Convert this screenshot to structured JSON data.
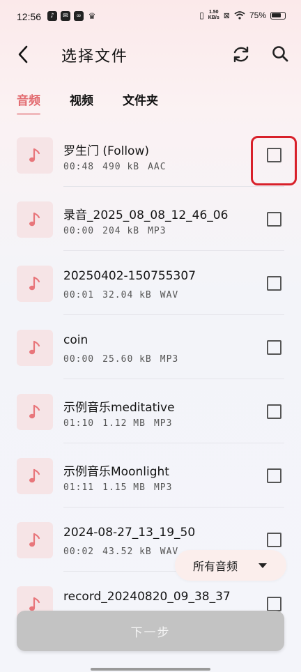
{
  "status_bar": {
    "time": "12:56",
    "net_speed_value": "1.50",
    "net_speed_unit": "KB/s",
    "battery": "75%"
  },
  "app_bar": {
    "title": "选择文件",
    "icons": [
      "back-arrow-icon",
      "refresh-icon",
      "search-icon"
    ]
  },
  "tabs": [
    {
      "label": "音频",
      "active": true
    },
    {
      "label": "视频",
      "active": false
    },
    {
      "label": "文件夹",
      "active": false
    }
  ],
  "files": [
    {
      "name": "罗生门 (Follow)",
      "duration": "00:48",
      "size": "490 kB",
      "format": "AAC",
      "checked": false
    },
    {
      "name": "录音_2025_08_08_12_46_06",
      "duration": "00:00",
      "size": "204 kB",
      "format": "MP3",
      "checked": false
    },
    {
      "name": "20250402-150755307",
      "duration": "00:01",
      "size": "32.04 kB",
      "format": "WAV",
      "checked": false
    },
    {
      "name": "coin",
      "duration": "00:00",
      "size": "25.60 kB",
      "format": "MP3",
      "checked": false
    },
    {
      "name": "示例音乐meditative",
      "duration": "01:10",
      "size": "1.12 MB",
      "format": "MP3",
      "checked": false
    },
    {
      "name": "示例音乐Moonlight",
      "duration": "01:11",
      "size": "1.15 MB",
      "format": "MP3",
      "checked": false
    },
    {
      "name": "2024-08-27_13_19_50",
      "duration": "00:02",
      "size": "43.52 kB",
      "format": "WAV",
      "checked": false
    },
    {
      "name": "record_20240820_09_38_37",
      "duration": "",
      "size": "",
      "format": "",
      "checked": false
    }
  ],
  "filter": {
    "label": "所有音频"
  },
  "next_button": {
    "label": "下一步"
  },
  "colors": {
    "accent": "#e26a6f",
    "highlight": "#d8202a",
    "button_disabled": "#c3c3c3"
  }
}
